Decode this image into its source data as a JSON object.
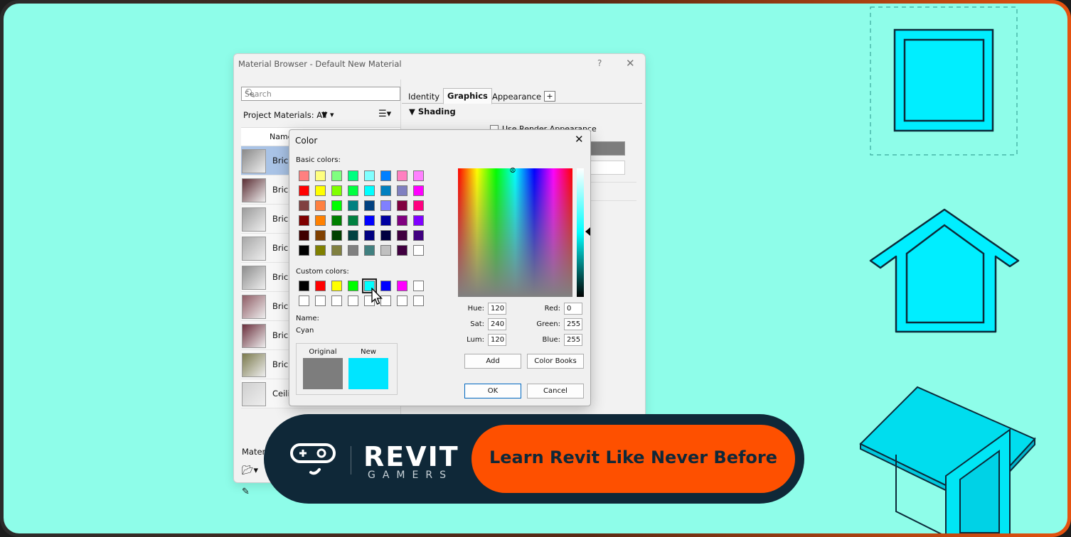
{
  "material_browser": {
    "title": "Material Browser - Default New Material",
    "help": "?",
    "close": "✕",
    "search_placeholder": "Search",
    "project_materials": "Project Materials: All",
    "filter_icon": "filter-icon",
    "column_name": "Name",
    "materials": [
      {
        "label": "Brick",
        "thumb": "#8a8a8a"
      },
      {
        "label": "Brick,",
        "thumb": "#5b2e34"
      },
      {
        "label": "Brick,",
        "thumb": "#9b9b9b"
      },
      {
        "label": "Brick,",
        "thumb": "#a7a7a7"
      },
      {
        "label": "Brick,",
        "thumb": "#8d8d8d"
      },
      {
        "label": "Brick,",
        "thumb": "#8f5c65"
      },
      {
        "label": "Brick,",
        "thumb": "#6b2f3c"
      },
      {
        "label": "Brick,",
        "thumb": "#7b7a4c"
      },
      {
        "label": "Ceilin",
        "thumb": "#cfcfcf"
      }
    ],
    "material_library": "Material Libra",
    "tabs": [
      "Identity",
      "Graphics",
      "Appearance"
    ],
    "active_tab": "Graphics",
    "add_tab": "+",
    "section": "▼ Shading",
    "use_render_appearance": "Use Render Appearance",
    "shading_color": "#7d7d7d"
  },
  "color_dialog": {
    "title": "Color",
    "close": "✕",
    "basic_colors_label": "Basic colors:",
    "basic_colors": [
      "#ff8080",
      "#ffff80",
      "#80ff80",
      "#00ff80",
      "#80ffff",
      "#0080ff",
      "#ff80c0",
      "#ff80ff",
      "#ff0000",
      "#ffff00",
      "#80ff00",
      "#00ff40",
      "#00ffff",
      "#0080c0",
      "#8080c0",
      "#ff00ff",
      "#804040",
      "#ff8040",
      "#00ff00",
      "#008080",
      "#004080",
      "#8080ff",
      "#800040",
      "#ff0080",
      "#800000",
      "#ff8000",
      "#008000",
      "#008040",
      "#0000ff",
      "#0000a0",
      "#800080",
      "#8000ff",
      "#400000",
      "#804000",
      "#004000",
      "#004040",
      "#000080",
      "#000040",
      "#400040",
      "#400080",
      "#000000",
      "#808000",
      "#808040",
      "#808080",
      "#408080",
      "#c0c0c0",
      "#400040",
      "#ffffff"
    ],
    "custom_colors_label": "Custom colors:",
    "custom_colors": [
      "#000000",
      "#ff0000",
      "#ffff00",
      "#00ff00",
      "#00ffff",
      "#0000ff",
      "#ff00ff",
      "#ffffff",
      "#ffffff",
      "#ffffff",
      "#ffffff",
      "#ffffff",
      "#ffffff",
      "#ffffff",
      "#ffffff",
      "#ffffff"
    ],
    "name_label": "Name:",
    "name_value": "Cyan",
    "original_label": "Original",
    "new_label": "New",
    "original_color": "#7d7d7d",
    "new_color": "#00e5ff",
    "hue_label": "Hue:",
    "hue": "120",
    "sat_label": "Sat:",
    "sat": "240",
    "lum_label": "Lum:",
    "lum": "120",
    "red_label": "Red:",
    "red": "0",
    "green_label": "Green:",
    "green": "255",
    "blue_label": "Blue:",
    "blue": "255",
    "add_button": "Add",
    "color_books_button": "Color Books",
    "ok_button": "OK",
    "cancel_button": "Cancel"
  },
  "banner": {
    "brand": "REVIT",
    "brand_sub": "GAMERS",
    "tagline": "Learn Revit Like Never Before"
  }
}
